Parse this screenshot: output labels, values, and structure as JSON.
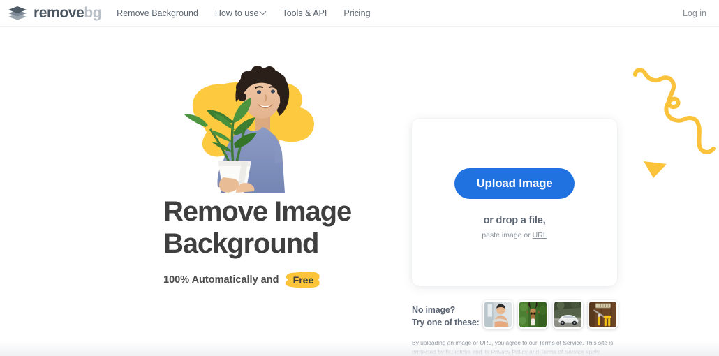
{
  "header": {
    "logo": {
      "dark": "remove",
      "light": "bg",
      "icon": "layers-diamond-icon"
    },
    "nav": [
      {
        "label": "Remove Background",
        "name": "nav-remove-background"
      },
      {
        "label": "How to use",
        "name": "nav-how-to-use",
        "has_chevron": true
      },
      {
        "label": "Tools & API",
        "name": "nav-tools-api"
      },
      {
        "label": "Pricing",
        "name": "nav-pricing"
      }
    ],
    "login_label": "Log in"
  },
  "hero": {
    "headline_line1": "Remove Image",
    "headline_line2": "Background",
    "sub_prefix": "100% Automatically and",
    "sub_badge": "Free",
    "image_alt": "man-holding-plant-photo"
  },
  "uploader": {
    "button_label": "Upload Image",
    "drop_text": "or drop a file,",
    "paste_prefix": "paste image or ",
    "paste_link": "URL"
  },
  "samples": {
    "label_line1": "No image?",
    "label_line2": "Try one of these:",
    "thumbs": [
      {
        "name": "sample-thumb-man",
        "alt": "man-sitting-photo"
      },
      {
        "name": "sample-thumb-antelope",
        "alt": "antelope-in-green-foliage-photo"
      },
      {
        "name": "sample-thumb-car",
        "alt": "white-car-on-road-photo"
      },
      {
        "name": "sample-thumb-paint-rollers",
        "alt": "paint-rollers-on-wood-photo"
      }
    ]
  },
  "legal": {
    "part1": "By uploading an image or URL, you agree to our ",
    "link1": "Terms of Service",
    "part2": ". This site is protected by hCaptcha and its ",
    "link2": "Privacy Policy",
    "part3": " and ",
    "link3": "Terms of Service",
    "part4": " apply."
  },
  "colors": {
    "accent_blue": "#1f72e0",
    "brand_yellow": "#fcc43a",
    "logo_dark": "#4a5560",
    "logo_light": "#b9c0c7",
    "heading": "#3f3f3f"
  }
}
